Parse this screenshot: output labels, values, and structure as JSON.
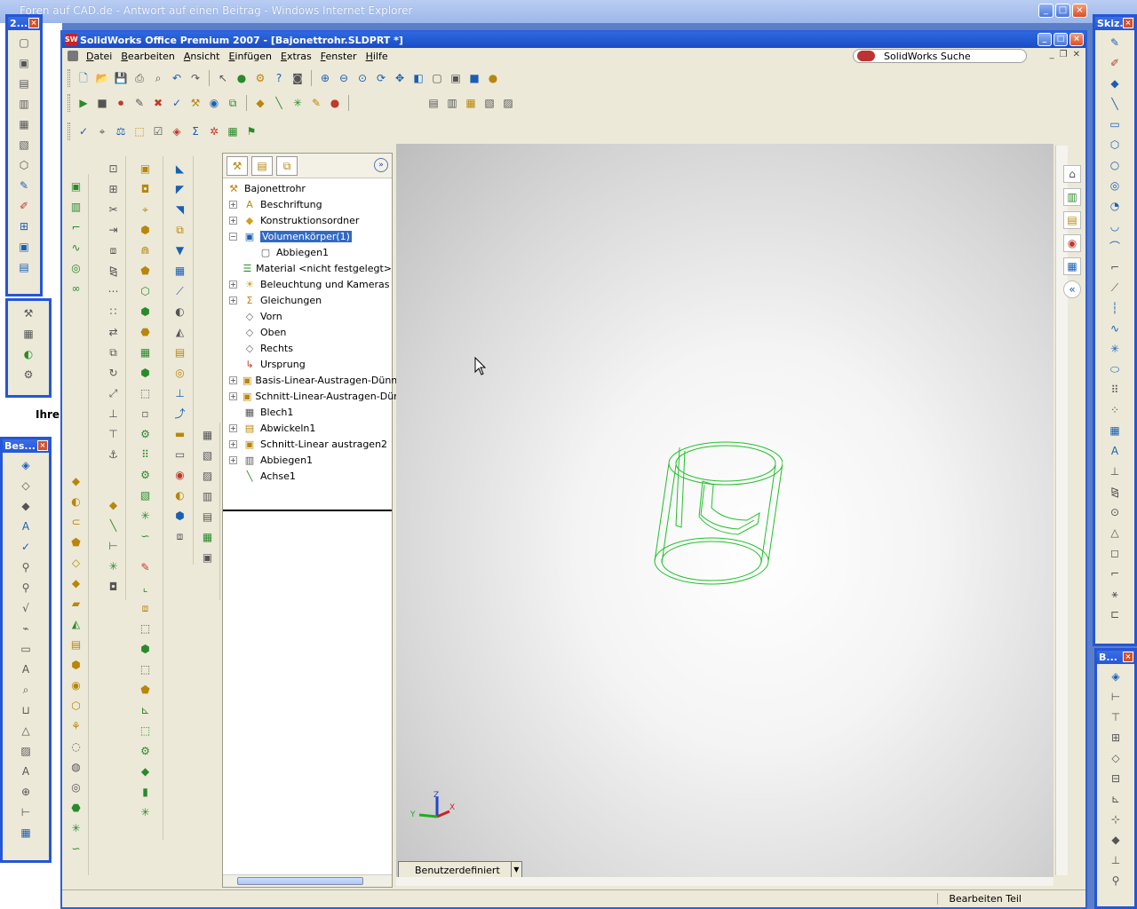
{
  "ie_window": {
    "title": "Foren auf CAD.de - Antwort auf einen Beitrag - Windows Internet Explorer",
    "partial_text": "Ihre"
  },
  "sw_window": {
    "title": "SolidWorks Office Premium 2007 - [Bajonettrohr.SLDPRT *]",
    "logo": "SW"
  },
  "menu": [
    "Datei",
    "Bearbeiten",
    "Ansicht",
    "Einfügen",
    "Extras",
    "Fenster",
    "Hilfe"
  ],
  "search": {
    "label": "SolidWorks Suche"
  },
  "feature_tree": {
    "root": "Bajonettrohr",
    "items": [
      {
        "label": "Beschriftung",
        "expander": "+",
        "icon": "annotation-icon"
      },
      {
        "label": "Konstruktionsordner",
        "expander": "+",
        "icon": "design-binder-icon"
      },
      {
        "label": "Volumenkörper(1)",
        "expander": "−",
        "icon": "solid-bodies-icon",
        "selected": true
      },
      {
        "label": "Abbiegen1",
        "expander": "",
        "icon": "body-icon",
        "indent": true
      },
      {
        "label": "Material <nicht festgelegt>",
        "expander": "",
        "icon": "material-icon"
      },
      {
        "label": "Beleuchtung und Kameras",
        "expander": "+",
        "icon": "lights-icon"
      },
      {
        "label": "Gleichungen",
        "expander": "+",
        "icon": "equations-icon"
      },
      {
        "label": "Vorn",
        "expander": "",
        "icon": "plane-icon"
      },
      {
        "label": "Oben",
        "expander": "",
        "icon": "plane-icon"
      },
      {
        "label": "Rechts",
        "expander": "",
        "icon": "plane-icon"
      },
      {
        "label": "Ursprung",
        "expander": "",
        "icon": "origin-icon"
      },
      {
        "label": "Basis-Linear-Austragen-Dünn",
        "expander": "+",
        "icon": "extrude-icon"
      },
      {
        "label": "Schnitt-Linear-Austragen-Dünn",
        "expander": "+",
        "icon": "cut-extrude-icon"
      },
      {
        "label": "Blech1",
        "expander": "",
        "icon": "sheet-metal-icon"
      },
      {
        "label": "Abwickeln1",
        "expander": "+",
        "icon": "unfold-icon"
      },
      {
        "label": "Schnitt-Linear austragen2",
        "expander": "+",
        "icon": "cut-extrude-icon"
      },
      {
        "label": "Abbiegen1",
        "expander": "+",
        "icon": "fold-icon"
      },
      {
        "label": "Achse1",
        "expander": "",
        "icon": "axis-icon"
      }
    ]
  },
  "floating_toolbars": {
    "left_top": "2...",
    "left_bottom": "Bes...",
    "right_top": "Skiz...",
    "right_bottom": "B..."
  },
  "view_orientation": {
    "label": "Benutzerdefiniert"
  },
  "status": {
    "mode": "Bearbeiten Teil"
  },
  "triad": {
    "x": "X",
    "y": "Y",
    "z": "Z"
  },
  "colors": {
    "wireframe": "#22c02a",
    "selection": "#316ac5",
    "titlebar": "#1a4cc4"
  }
}
